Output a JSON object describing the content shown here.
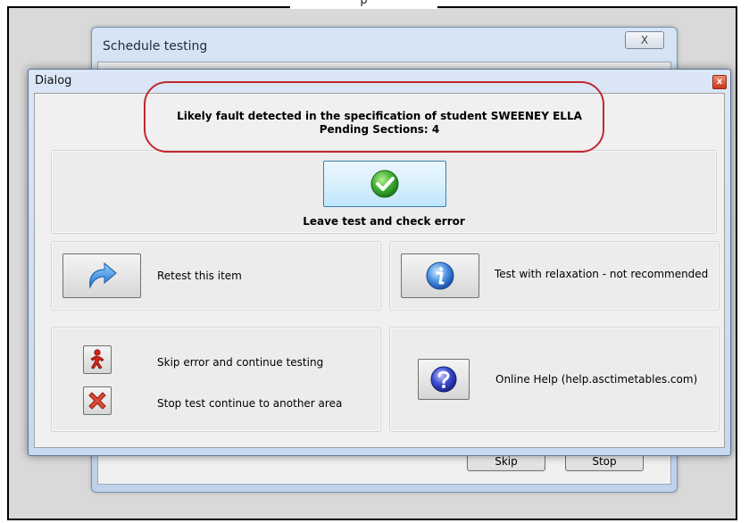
{
  "background_window": {
    "title": "Schedule testing",
    "close_glyph": "X",
    "buttons": [
      "Skip",
      "Stop"
    ]
  },
  "dialog": {
    "title": "Dialog",
    "close_glyph": "x",
    "message_line1": "Likely fault detected in the specification of student SWEENEY ELLA",
    "message_line2": "Pending Sections: 4",
    "leave_label": "Leave test and check error",
    "retest_label": "Retest this item",
    "relax_label": "Test with relaxation - not recommended",
    "skip_label": "Skip error and continue testing",
    "stop_label": "Stop test  continue to another area",
    "help_label": "Online Help (help.asctimetables.com)"
  },
  "icons": {
    "leave": "green-check-icon",
    "retest": "blue-redo-arrow-icon",
    "relax": "blue-info-icon",
    "skip": "red-running-figure-icon",
    "stop": "red-x-icon",
    "help": "blue-question-icon"
  },
  "colors": {
    "highlight_ring": "#c0282f",
    "check_green": "#3aa832",
    "info_blue": "#2f6fd3",
    "stop_red": "#d42a1e"
  }
}
